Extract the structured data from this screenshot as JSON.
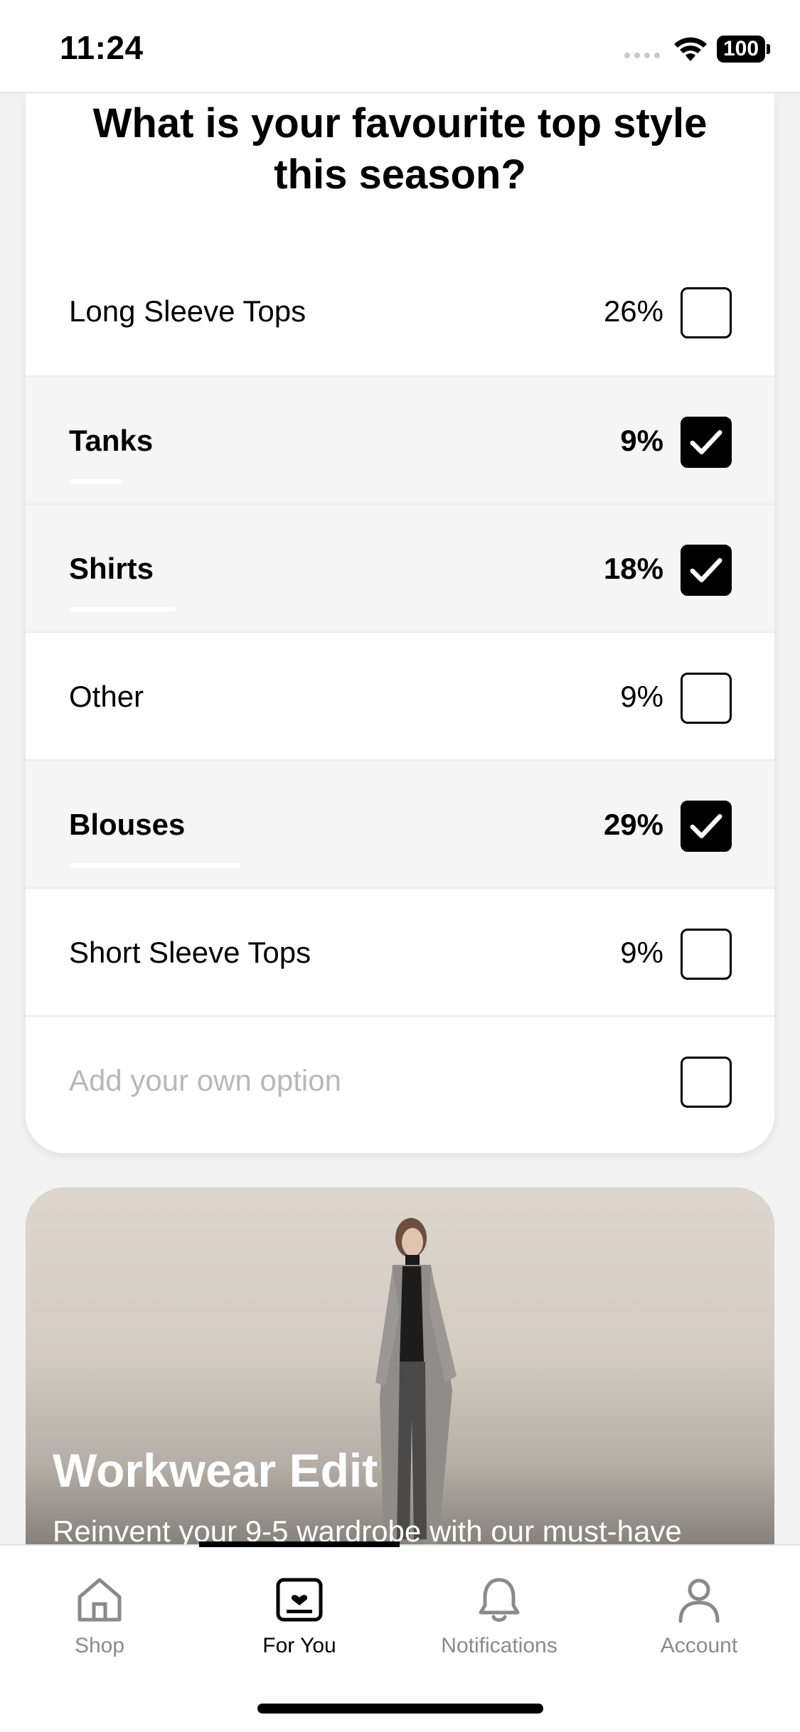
{
  "status_bar": {
    "time": "11:24",
    "battery": "100"
  },
  "poll": {
    "question": "What is your favourite top style this season?",
    "options": [
      {
        "label": "Long Sleeve Tops",
        "percent": "26%",
        "checked": false
      },
      {
        "label": "Tanks",
        "percent": "9%",
        "checked": true
      },
      {
        "label": "Shirts",
        "percent": "18%",
        "checked": true
      },
      {
        "label": "Other",
        "percent": "9%",
        "checked": false
      },
      {
        "label": "Blouses",
        "percent": "29%",
        "checked": true
      },
      {
        "label": "Short Sleeve Tops",
        "percent": "9%",
        "checked": false
      }
    ],
    "add_option_placeholder": "Add your own option"
  },
  "promo": {
    "title": "Workwear Edit",
    "subtitle": "Reinvent your 9-5 wardrobe with our must-have"
  },
  "tabs": [
    {
      "label": "Shop",
      "icon": "home-icon",
      "active": false
    },
    {
      "label": "For You",
      "icon": "for-you-icon",
      "active": true
    },
    {
      "label": "Notifications",
      "icon": "bell-icon",
      "active": false
    },
    {
      "label": "Account",
      "icon": "person-icon",
      "active": false
    }
  ]
}
